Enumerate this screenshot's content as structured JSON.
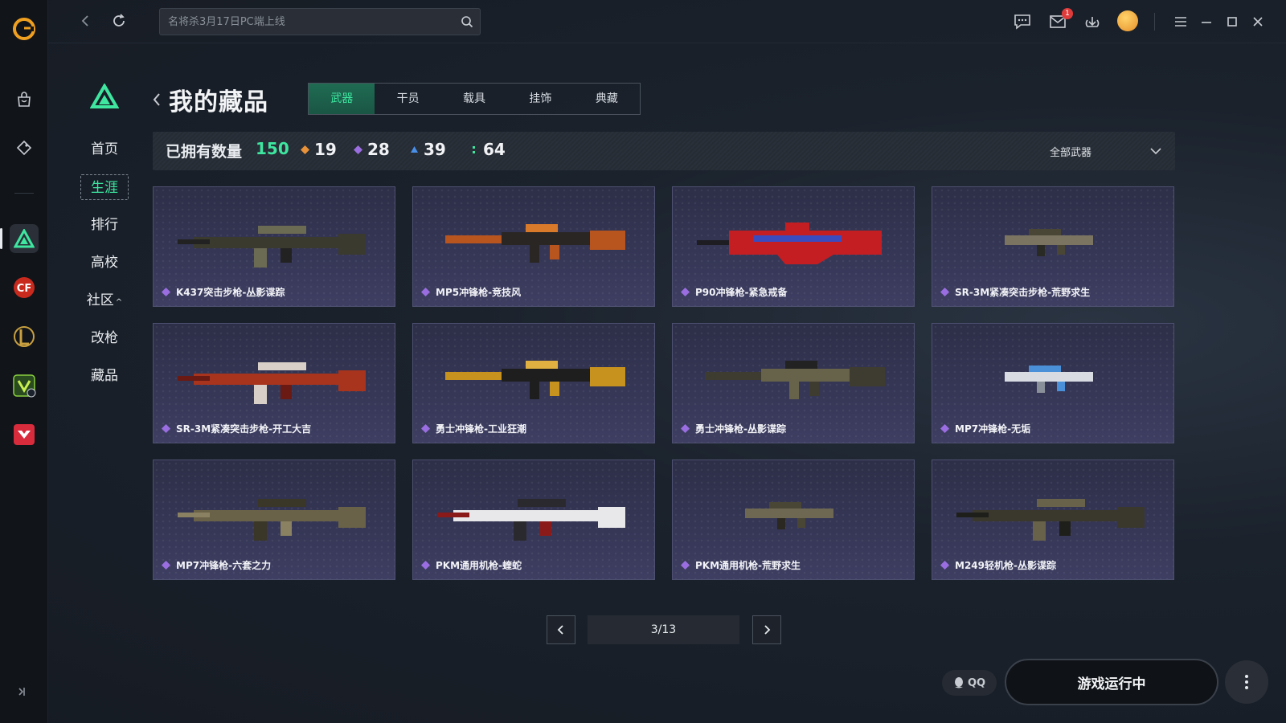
{
  "search": {
    "placeholder": "名将杀3月17日PC端上线"
  },
  "topbar": {
    "mail_badge": "1"
  },
  "inner_nav": {
    "items": [
      {
        "label": "首页",
        "active": false
      },
      {
        "label": "生涯",
        "active": true
      },
      {
        "label": "排行",
        "active": false
      },
      {
        "label": "高校",
        "active": false
      },
      {
        "label": "社区",
        "active": false
      },
      {
        "label": "改枪",
        "active": false
      },
      {
        "label": "藏品",
        "active": false
      }
    ]
  },
  "header": {
    "title": "我的藏品"
  },
  "tabs": [
    "武器",
    "干员",
    "载具",
    "挂饰",
    "典藏"
  ],
  "stats": {
    "label": "已拥有数量",
    "total": "150",
    "counts": [
      {
        "value": "19",
        "color": "#e8923a"
      },
      {
        "value": "28",
        "color": "#9a6ee0"
      },
      {
        "value": "39",
        "color": "#4a8fe8"
      },
      {
        "value": "64",
        "color": "#3ee6a0"
      }
    ],
    "filter": "全部武器"
  },
  "weapons": [
    {
      "name": "K437突击步枪-丛影谍踪",
      "rarity": "#9a6ee0",
      "palette": [
        "#3a3a2e",
        "#6b6a52",
        "#222"
      ]
    },
    {
      "name": "MP5冲锋枪-竞技风",
      "rarity": "#9a6ee0",
      "palette": [
        "#b8541e",
        "#2a2624",
        "#d97a2a"
      ]
    },
    {
      "name": "P90冲锋枪-紧急戒备",
      "rarity": "#9a6ee0",
      "palette": [
        "#c41e22",
        "#1d1d22",
        "#3a4bbf"
      ]
    },
    {
      "name": "SR-3M紧凑突击步枪-荒野求生",
      "rarity": "#9a6ee0",
      "palette": [
        "#7a7460",
        "#4a4636",
        "#2a2a24"
      ]
    },
    {
      "name": "SR-3M紧凑突击步枪-开工大吉",
      "rarity": "#9a6ee0",
      "palette": [
        "#a8341e",
        "#d8d0c8",
        "#6a1a12"
      ]
    },
    {
      "name": "勇士冲锋枪-工业狂潮",
      "rarity": "#9a6ee0",
      "palette": [
        "#c8921e",
        "#1e1e1e",
        "#e0b040"
      ]
    },
    {
      "name": "勇士冲锋枪-丛影谍踪",
      "rarity": "#9a6ee0",
      "palette": [
        "#3e3c30",
        "#67624a",
        "#222"
      ]
    },
    {
      "name": "MP7冲锋枪-无垢",
      "rarity": "#9a6ee0",
      "palette": [
        "#d8dce2",
        "#4a90d8",
        "#8a9099"
      ]
    },
    {
      "name": "MP7冲锋枪-六套之力",
      "rarity": "#9a6ee0",
      "palette": [
        "#6a6248",
        "#3a3628",
        "#8a8062"
      ]
    },
    {
      "name": "PKM通用机枪-蝰蛇",
      "rarity": "#9a6ee0",
      "palette": [
        "#e8e8ea",
        "#2a2a2e",
        "#8a1a1a"
      ]
    },
    {
      "name": "PKM通用机枪-荒野求生",
      "rarity": "#9a6ee0",
      "palette": [
        "#6e6852",
        "#4a4636",
        "#2a2820"
      ]
    },
    {
      "name": "M249轻机枪-丛影谍踪",
      "rarity": "#9a6ee0",
      "palette": [
        "#3a382c",
        "#68624a",
        "#1e1e1a"
      ]
    }
  ],
  "pagination": {
    "label": "3/13"
  },
  "footer": {
    "qq_label": "QQ",
    "run_label": "游戏运行中"
  }
}
